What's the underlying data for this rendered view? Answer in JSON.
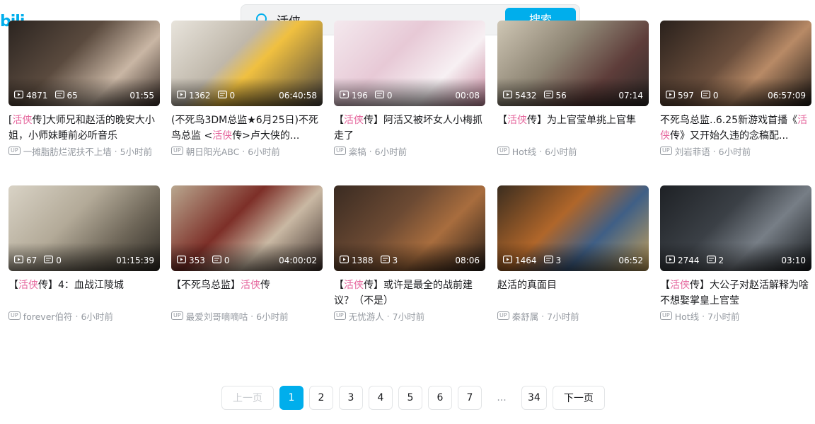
{
  "header": {
    "logo": "bili",
    "search_value": "活侠",
    "search_button": "搜索"
  },
  "videos": [
    {
      "plays": "4871",
      "danmaku": "65",
      "duration": "01:55",
      "kw": "活侠",
      "t_pre": "[",
      "t_post": "传]大师兄和赵活的晚安大小姐，小师妹睡前必听音乐",
      "author": "一摊脂肪烂泥扶不上墙",
      "time": "5小时前"
    },
    {
      "plays": "1362",
      "danmaku": "0",
      "duration": "06:40:58",
      "kw": "活侠",
      "t_pre": "(不死鸟3DM总监★6月25日)不死鸟总监 <",
      "t_post": "传>卢大侠的...",
      "author": "朝日阳光ABC",
      "time": "6小时前"
    },
    {
      "plays": "196",
      "danmaku": "0",
      "duration": "00:08",
      "kw": "活侠",
      "t_pre": "【",
      "t_post": "传】阿活又被坏女人小梅抓走了",
      "author": "粢犒",
      "time": "6小时前"
    },
    {
      "plays": "5432",
      "danmaku": "56",
      "duration": "07:14",
      "kw": "活侠",
      "t_pre": "【",
      "t_post": "传】为上官莹单挑上官隼",
      "author": "Hot线",
      "time": "6小时前"
    },
    {
      "plays": "597",
      "danmaku": "0",
      "duration": "06:57:09",
      "kw": "活侠",
      "t_pre": "不死鸟总监..6.25新游戏首播《",
      "t_post": "传》又开始久违的念稿配...",
      "author": "刘岩菲语",
      "time": "6小时前"
    },
    {
      "plays": "67",
      "danmaku": "0",
      "duration": "01:15:39",
      "kw": "活侠",
      "t_pre": "【",
      "t_post": "传】4：血战江陵城",
      "author": "forever伯符",
      "time": "6小时前"
    },
    {
      "plays": "353",
      "danmaku": "0",
      "duration": "04:00:02",
      "kw": "活侠",
      "t_pre": "【不死鸟总监】",
      "t_post": "传",
      "author": "最爱刘哥嘀嘀咕",
      "time": "6小时前"
    },
    {
      "plays": "1388",
      "danmaku": "3",
      "duration": "08:06",
      "kw": "活侠",
      "t_pre": "【",
      "t_post": "传】或许是最全的战前建议？（不是）",
      "author": "无忧游人",
      "time": "7小时前"
    },
    {
      "plays": "1464",
      "danmaku": "3",
      "duration": "06:52",
      "kw": "",
      "t_pre": "赵活的真面目",
      "t_post": "",
      "author": "秦舒属",
      "time": "7小时前"
    },
    {
      "plays": "2744",
      "danmaku": "2",
      "duration": "03:10",
      "kw": "活侠",
      "t_pre": "【",
      "t_post": "传】大公子对赵活解释为啥不想娶掌皇上官莹",
      "author": "Hot线",
      "time": "7小时前"
    }
  ],
  "pagination": {
    "prev": "上一页",
    "pages": [
      "1",
      "2",
      "3",
      "4",
      "5",
      "6",
      "7"
    ],
    "ellipsis": "...",
    "last": "34",
    "next": "下一页",
    "current": "1"
  },
  "colors": {
    "accent": "#00aeec",
    "keyword": "#e5659c",
    "meta": "#9499a0"
  },
  "icons": {
    "search": "search-icon",
    "play": "play-count-icon",
    "danmaku": "danmaku-icon",
    "up": "up-badge-icon"
  }
}
